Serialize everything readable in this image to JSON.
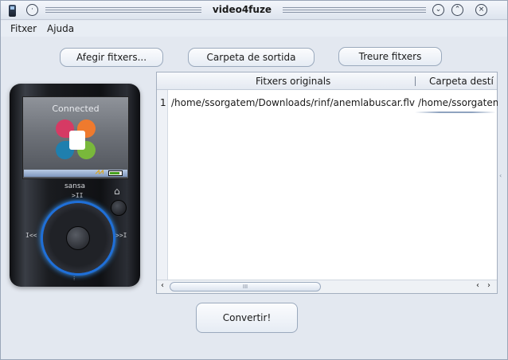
{
  "window": {
    "title": "video4fuze",
    "background": "#e3e8f0",
    "titlebar_icons": [
      "app-icon",
      "window-menu-icon",
      "minimize-icon",
      "maximize-icon",
      "close-icon"
    ]
  },
  "menu": {
    "items": [
      {
        "label": "Fitxer"
      },
      {
        "label": "Ajuda"
      }
    ]
  },
  "toolbar": {
    "add_files": "Afegir fitxers...",
    "output_folder": "Carpeta de sortida",
    "remove_files": "Treure fitxers"
  },
  "device": {
    "screen_status": "Connected",
    "brand": "sansa",
    "play_label": ">II",
    "prev_label": "I<<",
    "next_label": ">>I",
    "bottom_label": "⁝",
    "accent": "#3a9bff"
  },
  "table": {
    "columns": [
      "Fitxers originals",
      "Carpeta destí"
    ],
    "rows": [
      {
        "number": "1",
        "original": "/home/ssorgatem/Downloads/rinf/anemlabuscar.flv",
        "destination": "/home/ssorgatem"
      }
    ],
    "scrollbar": {
      "grip": "III",
      "left_arrow": "‹",
      "right_arrow": "›"
    }
  },
  "actions": {
    "convert": "Convertir!"
  }
}
